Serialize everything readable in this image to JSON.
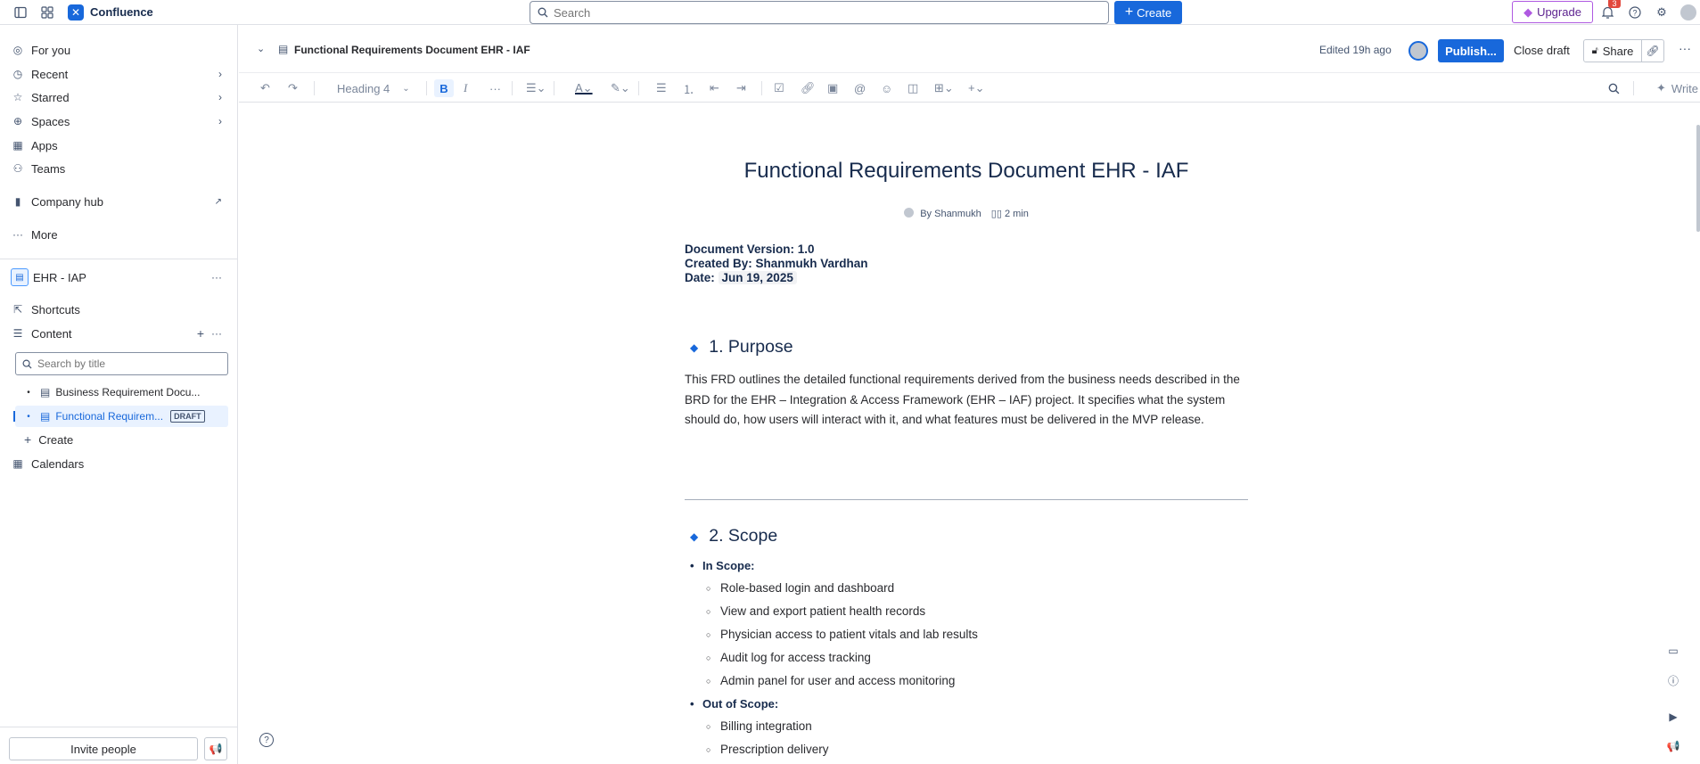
{
  "topbar": {
    "app_name": "Confluence",
    "search_placeholder": "Search",
    "create_label": "Create",
    "upgrade_label": "Upgrade",
    "notification_count": "3"
  },
  "sidebar": {
    "nav": [
      {
        "label": "For you"
      },
      {
        "label": "Recent"
      },
      {
        "label": "Starred"
      },
      {
        "label": "Spaces"
      },
      {
        "label": "Apps"
      },
      {
        "label": "Teams"
      }
    ],
    "company_hub": "Company hub",
    "more": "More",
    "space_name": "EHR - IAP",
    "shortcuts": "Shortcuts",
    "content": "Content",
    "title_search_placeholder": "Search by title",
    "tree": [
      {
        "label": "Business Requirement Docu..."
      },
      {
        "label": "Functional Requirem...",
        "badge": "DRAFT"
      }
    ],
    "create": "Create",
    "calendars": "Calendars",
    "invite": "Invite people"
  },
  "header": {
    "breadcrumb_title": "Functional Requirements Document EHR - IAF",
    "edited": "Edited 19h ago",
    "publish": "Publish...",
    "close_draft": "Close draft",
    "share": "Share"
  },
  "toolbar": {
    "text_style": "Heading 4",
    "write_label": "Write"
  },
  "doc": {
    "title": "Functional Requirements Document EHR - IAF",
    "byline_author": "By Shanmukh",
    "byline_read": "2 min",
    "version": "Document Version: 1.0",
    "created_by": "Created By: Shanmukh Vardhan",
    "date_label": "Date:",
    "date_value": "Jun 19, 2025",
    "purpose_heading": "1. Purpose",
    "purpose_text": "This FRD outlines the detailed functional requirements derived from the business needs described in the BRD for the EHR – Integration & Access Framework (EHR – IAF) project. It specifies what the system should do, how users will interact with it, and what features must be delivered in the MVP release.",
    "scope_heading": "2. Scope",
    "in_scope_label": "In Scope:",
    "in_scope": [
      "Role-based login and dashboard",
      "View and export patient health records",
      "Physician access to patient vitals and lab results",
      "Audit log for access tracking",
      "Admin panel for user and access monitoring"
    ],
    "out_scope_label": "Out of Scope:",
    "out_scope": [
      "Billing integration",
      "Prescription delivery"
    ]
  }
}
